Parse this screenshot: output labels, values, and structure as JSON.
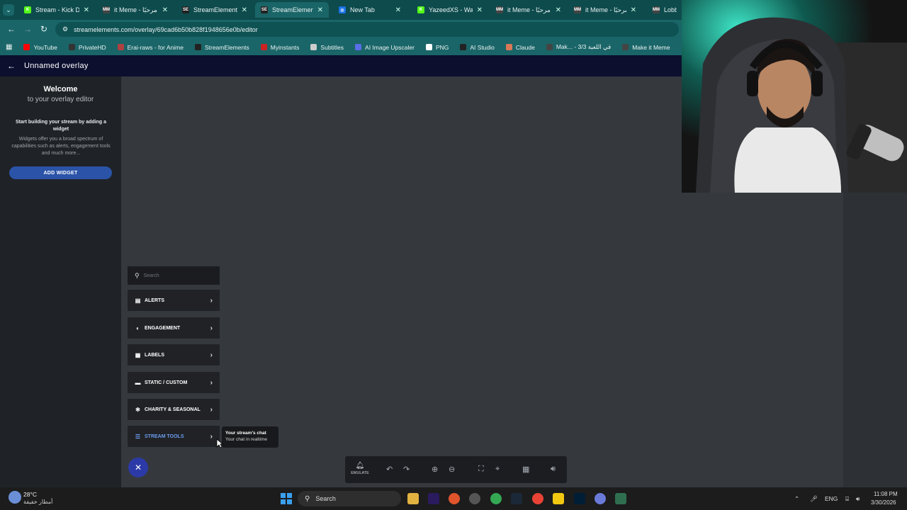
{
  "browser": {
    "tabs": [
      {
        "title": "Stream - Kick Da",
        "fav_color": "#53fc18",
        "fav_text": "K",
        "active": false
      },
      {
        "title": "it Meme - مرحبًا",
        "fav_color": "#444444",
        "fav_text": "MM",
        "active": false
      },
      {
        "title": "StreamElements",
        "fav_color": "#222222",
        "fav_text": "SE",
        "active": false
      },
      {
        "title": "StreamElements",
        "fav_color": "#222222",
        "fav_text": "SE",
        "active": true
      },
      {
        "title": "New Tab",
        "fav_color": "#1a73e8",
        "fav_text": "◎",
        "active": false
      },
      {
        "title": "YazeedXS - Watch",
        "fav_color": "#53fc18",
        "fav_text": "K",
        "active": false
      },
      {
        "title": "it Meme - مرحبًا",
        "fav_color": "#444444",
        "fav_text": "MM",
        "active": false
      },
      {
        "title": "it Meme - مرحبًا",
        "fav_color": "#444444",
        "fav_text": "MM",
        "active": false
      },
      {
        "title": "Lobby i",
        "fav_color": "#444444",
        "fav_text": "MM",
        "active": false
      }
    ],
    "url": "streamelements.com/overlay/69cad6b50b828f1948656e0b/editor",
    "bookmarks": [
      {
        "label": "YouTube",
        "color": "#ff0000"
      },
      {
        "label": "PrivateHD",
        "color": "#333333"
      },
      {
        "label": "Erai-raws - for Anime",
        "color": "#b04040"
      },
      {
        "label": "StreamElements",
        "color": "#222222"
      },
      {
        "label": "Myinstants",
        "color": "#cc2222"
      },
      {
        "label": "Subtitles",
        "color": "#cccccc"
      },
      {
        "label": "AI Image Upscaler",
        "color": "#5a6ee6"
      },
      {
        "label": "PNG",
        "color": "#ffffff"
      },
      {
        "label": "AI Studio",
        "color": "#222222"
      },
      {
        "label": "Claude",
        "color": "#d97757"
      },
      {
        "label": "Mak... - 3/3 في اللعبة",
        "color": "#444444"
      },
      {
        "label": "Make it Meme",
        "color": "#444444"
      }
    ]
  },
  "editor": {
    "title": "Unnamed overlay",
    "welcome_title": "Welcome",
    "welcome_sub": "to your overlay editor",
    "start_text": "Start building your stream by adding a widget",
    "desc_text": "Widgets offer you a broad spectrum of capabilities such as alerts, engagement tools and much more...",
    "add_widget": "ADD WIDGET",
    "search_placeholder": "Search",
    "menu": [
      {
        "label": "ALERTS",
        "icon": "alerts-icon",
        "glyph": "▤",
        "active": false
      },
      {
        "label": "ENGAGEMENT",
        "icon": "engagement-icon",
        "glyph": "◐",
        "active": false
      },
      {
        "label": "LABELS",
        "icon": "labels-icon",
        "glyph": "▦",
        "active": false
      },
      {
        "label": "STATIC / CUSTOM",
        "icon": "static-icon",
        "glyph": "▬",
        "active": false
      },
      {
        "label": "CHARITY & SEASONAL",
        "icon": "snowflake-icon",
        "glyph": "✻",
        "active": false
      },
      {
        "label": "STREAM TOOLS",
        "icon": "stream-tools-icon",
        "glyph": "☰",
        "active": true
      }
    ],
    "tooltip_title": "Your stream's chat",
    "tooltip_sub": "Your chat in realtime",
    "emulate": "EMULATE"
  },
  "taskbar": {
    "weather_temp": "28°C",
    "weather_desc": "أمطار خفيفة",
    "search": "Search",
    "lang": "ENG",
    "time": "11:08 PM",
    "date": "3/30/2026"
  }
}
